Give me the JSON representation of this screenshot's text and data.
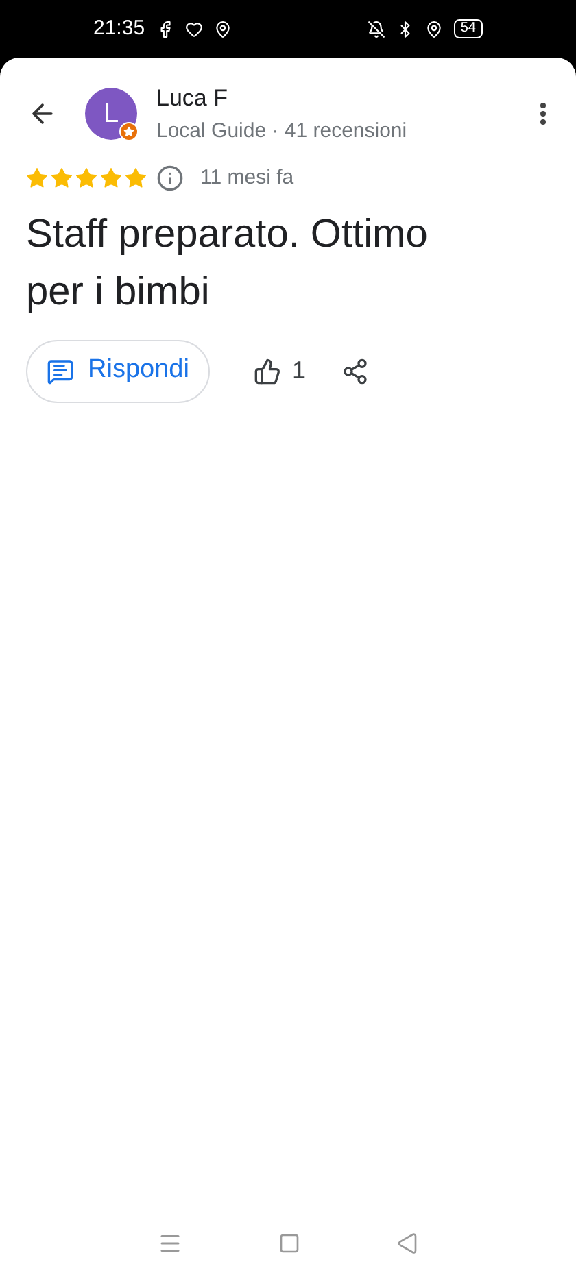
{
  "status_bar": {
    "time": "21:35",
    "battery": "54"
  },
  "reviewer": {
    "avatar_letter": "L",
    "name": "Luca F",
    "subtitle": "Local Guide · 41 recensioni"
  },
  "review": {
    "stars": 5,
    "date": "11 mesi fa",
    "text": "Staff preparato. Ottimo per i bimbi"
  },
  "actions": {
    "reply": "Rispondi",
    "likes": "1"
  }
}
